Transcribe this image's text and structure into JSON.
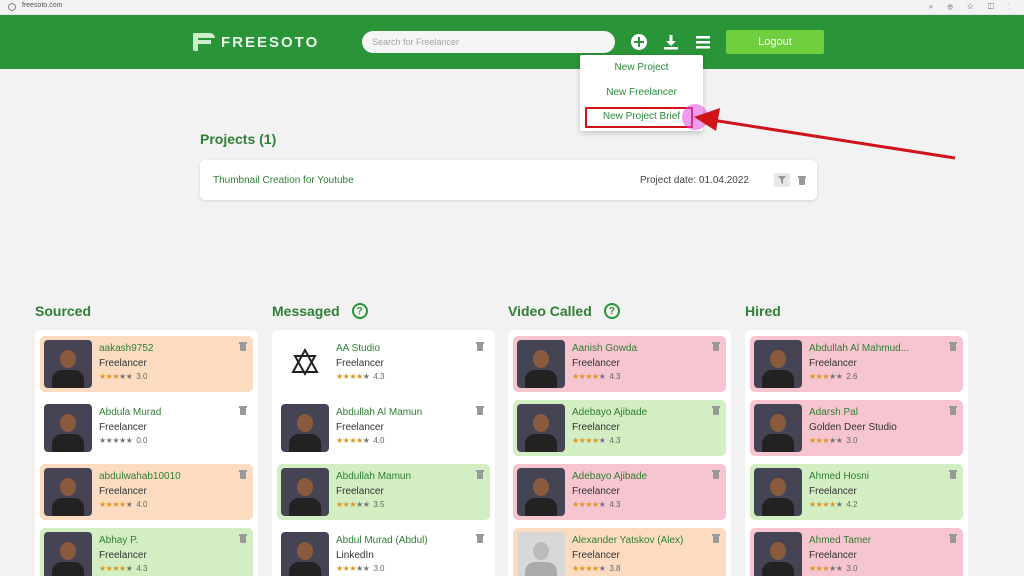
{
  "browser": {
    "url": "freesoto.com"
  },
  "header": {
    "logo_text": "FREESOTO",
    "search_placeholder": "Search for Freelancer",
    "logout_label": "Logout"
  },
  "dropdown": {
    "items": [
      "New Project",
      "New Freelancer",
      "New Project Brief"
    ]
  },
  "projects": {
    "title": "Projects (1)",
    "items": [
      {
        "name": "Thumbnail Creation for Youtube",
        "date": "Project date: 01.04.2022"
      }
    ]
  },
  "columns": [
    {
      "title": "Sourced",
      "has_help": false,
      "cards": [
        {
          "name": "aakash9752",
          "role": "Freelancer",
          "rating": "3.0",
          "stars": 3,
          "color": "orange"
        },
        {
          "name": "Abdula Murad",
          "role": "Freelancer",
          "rating": "0.0",
          "stars": 0,
          "color": "white"
        },
        {
          "name": "abdulwahab10010",
          "role": "Freelancer",
          "rating": "4.0",
          "stars": 4,
          "color": "orange"
        },
        {
          "name": "Abhay P.",
          "role": "Freelancer",
          "rating": "4.3",
          "stars": 4,
          "color": "green"
        }
      ]
    },
    {
      "title": "Messaged",
      "has_help": true,
      "cards": [
        {
          "name": "AA Studio",
          "role": "Freelancer",
          "rating": "4.3",
          "stars": 4,
          "color": "white"
        },
        {
          "name": "Abdullah Al Mamun",
          "role": "Freelancer",
          "rating": "4.0",
          "stars": 4,
          "color": "white"
        },
        {
          "name": "Abdullah Mamun",
          "role": "Freelancer",
          "rating": "3.5",
          "stars": 3,
          "color": "green"
        },
        {
          "name": "Abdul Murad (Abdul)",
          "role": "LinkedIn",
          "rating": "3.0",
          "stars": 3,
          "color": "white"
        }
      ]
    },
    {
      "title": "Video Called",
      "has_help": true,
      "cards": [
        {
          "name": "Aanish Gowda",
          "role": "Freelancer",
          "rating": "4.3",
          "stars": 4,
          "color": "pink"
        },
        {
          "name": "Adebayo Ajibade",
          "role": "Freelancer",
          "rating": "4.3",
          "stars": 4,
          "color": "green"
        },
        {
          "name": "Adebayo Ajibade",
          "role": "Freelancer",
          "rating": "4.3",
          "stars": 4,
          "color": "pink"
        },
        {
          "name": "Alexander Yatskov (Alex)",
          "role": "Freelancer",
          "rating": "3.8",
          "stars": 4,
          "color": "orange"
        }
      ]
    },
    {
      "title": "Hired",
      "has_help": false,
      "cards": [
        {
          "name": "Abdullah Al Mahmud...",
          "role": "Freelancer",
          "rating": "2.6",
          "stars": 3,
          "color": "pink"
        },
        {
          "name": "Adarsh Pal",
          "role": "Golden Deer Studio",
          "rating": "3.0",
          "stars": 3,
          "color": "pink"
        },
        {
          "name": "Ahmed Hosni",
          "role": "Freelancer",
          "rating": "4.2",
          "stars": 4,
          "color": "green"
        },
        {
          "name": "Ahmed Tamer",
          "role": "Freelancer",
          "rating": "3.0",
          "stars": 3,
          "color": "pink"
        }
      ]
    }
  ],
  "colors": {
    "brand_green": "#2a9438",
    "logout_green": "#6fcf3f",
    "highlight_red": "#d0121b"
  }
}
